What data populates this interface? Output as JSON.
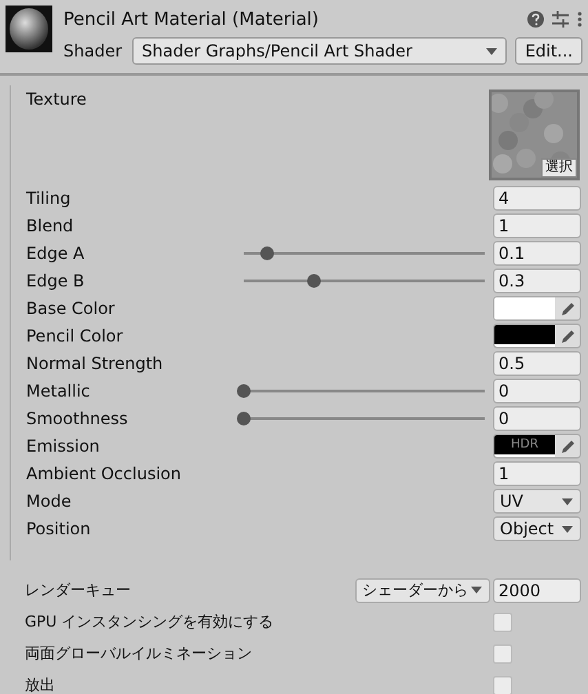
{
  "header": {
    "title": "Pencil Art Material (Material)",
    "shader_label": "Shader",
    "shader": "Shader Graphs/Pencil Art Shader",
    "edit_button": "Edit..."
  },
  "properties": [
    {
      "kind": "texture",
      "label": "Texture",
      "button": "選択"
    },
    {
      "kind": "float",
      "label": "Tiling",
      "value": "4"
    },
    {
      "kind": "float",
      "label": "Blend",
      "value": "1"
    },
    {
      "kind": "slider",
      "label": "Edge A",
      "level": 0.1,
      "value": "0.1"
    },
    {
      "kind": "slider",
      "label": "Edge B",
      "level": 0.3,
      "value": "0.3"
    },
    {
      "kind": "color",
      "label": "Base Color",
      "color": "#ffffff"
    },
    {
      "kind": "color",
      "label": "Pencil Color",
      "color": "#000000"
    },
    {
      "kind": "float",
      "label": "Normal Strength",
      "value": "0.5"
    },
    {
      "kind": "slider",
      "label": "Metallic",
      "level": 0,
      "value": "0"
    },
    {
      "kind": "slider",
      "label": "Smoothness",
      "level": 0,
      "value": "0"
    },
    {
      "kind": "hdr_color",
      "label": "Emission",
      "color": "#000000",
      "badge": "HDR"
    },
    {
      "kind": "float",
      "label": "Ambient Occlusion",
      "value": "1"
    },
    {
      "kind": "dropdown",
      "label": "Mode",
      "value": "UV"
    },
    {
      "kind": "dropdown",
      "label": "Position",
      "value": "Object"
    }
  ],
  "advanced": [
    {
      "kind": "queue",
      "label": "レンダーキュー",
      "dropdown": "シェーダーから",
      "value": "2000"
    },
    {
      "kind": "checkbox",
      "label": "GPU インスタンシングを有効にする",
      "checked": false
    },
    {
      "kind": "checkbox",
      "label": "両面グローバルイルミネーション",
      "checked": false
    },
    {
      "kind": "checkbox",
      "label": "放出",
      "checked": false
    }
  ]
}
